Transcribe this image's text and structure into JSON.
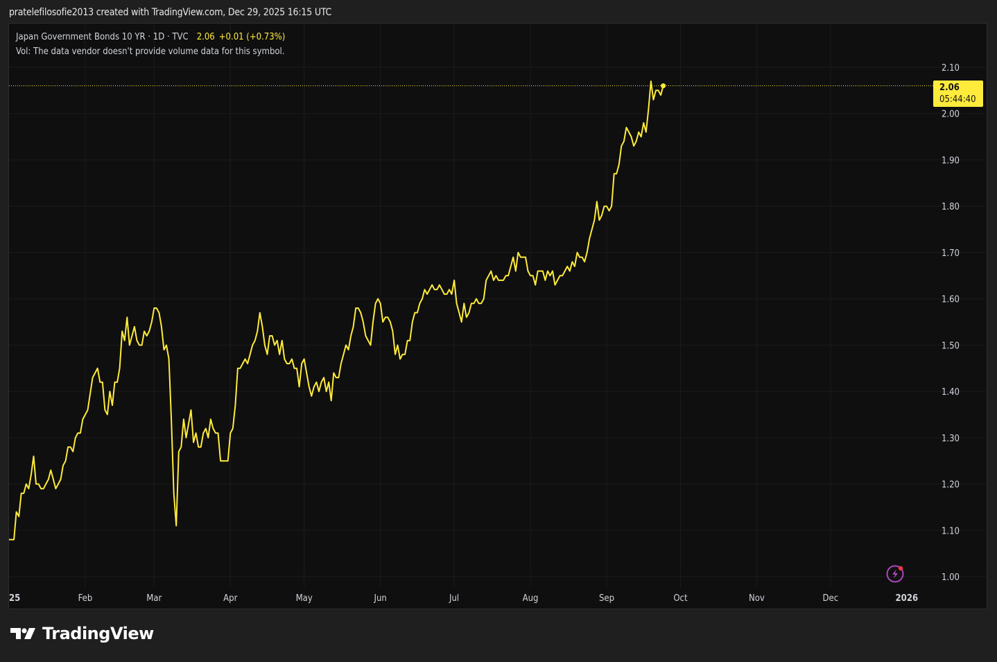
{
  "header": {
    "attribution": "pratelefilosofie2013 created with TradingView.com, Dec 29, 2025 16:15 UTC"
  },
  "legend": {
    "symbol": "Japan Government Bonds 10 YR · 1D · TVC",
    "last": "2.06",
    "change": "+0.01 (+0.73%)",
    "vol_note": "Vol: The data vendor doesn't provide volume data for this symbol."
  },
  "price_tag": {
    "price": "2.06",
    "countdown": "05:44:40"
  },
  "footer": {
    "brand": "TradingView"
  },
  "colors": {
    "line": "#ffeb3b",
    "background": "#0f0f0f",
    "grid": "#1c1c1c",
    "text": "#d1d4dc",
    "alert_icon": "#ab47bc",
    "alert_dot": "#f23645"
  },
  "icons": {
    "alert": "lightning-alert-icon",
    "logo": "tradingview-logo-icon"
  },
  "chart_data": {
    "type": "line",
    "title": "",
    "xlabel": "",
    "ylabel": "",
    "ylim": [
      1.0,
      2.1
    ],
    "yticks": [
      "2.10",
      "2.00",
      "1.90",
      "1.80",
      "1.70",
      "1.60",
      "1.50",
      "1.40",
      "1.30",
      "1.20",
      "1.10",
      "1.00"
    ],
    "xticks": [
      {
        "label": "25",
        "day": 0
      },
      {
        "label": "Feb",
        "day": 31
      },
      {
        "label": "Mar",
        "day": 59
      },
      {
        "label": "Apr",
        "day": 90
      },
      {
        "label": "May",
        "day": 120
      },
      {
        "label": "Jun",
        "day": 151
      },
      {
        "label": "Jul",
        "day": 181
      },
      {
        "label": "Aug",
        "day": 212
      },
      {
        "label": "Sep",
        "day": 243
      },
      {
        "label": "Oct",
        "day": 273
      },
      {
        "label": "Nov",
        "day": 304
      },
      {
        "label": "Dec",
        "day": 334
      },
      {
        "label": "2026",
        "day": 365
      }
    ],
    "grid": true,
    "last_value": 2.06,
    "series": [
      {
        "points": [
          [
            0,
            1.08
          ],
          [
            2,
            1.08
          ],
          [
            3,
            1.14
          ],
          [
            4,
            1.13
          ],
          [
            5,
            1.18
          ],
          [
            6,
            1.18
          ],
          [
            7,
            1.2
          ],
          [
            8,
            1.19
          ],
          [
            9,
            1.22
          ],
          [
            10,
            1.26
          ],
          [
            11,
            1.2
          ],
          [
            12,
            1.2
          ],
          [
            13,
            1.19
          ],
          [
            14,
            1.19
          ],
          [
            15,
            1.2
          ],
          [
            16,
            1.21
          ],
          [
            17,
            1.23
          ],
          [
            18,
            1.21
          ],
          [
            19,
            1.19
          ],
          [
            20,
            1.2
          ],
          [
            21,
            1.21
          ],
          [
            22,
            1.24
          ],
          [
            23,
            1.25
          ],
          [
            24,
            1.28
          ],
          [
            25,
            1.28
          ],
          [
            26,
            1.27
          ],
          [
            27,
            1.3
          ],
          [
            28,
            1.31
          ],
          [
            29,
            1.31
          ],
          [
            30,
            1.34
          ],
          [
            31,
            1.35
          ],
          [
            32,
            1.36
          ],
          [
            34,
            1.43
          ],
          [
            35,
            1.44
          ],
          [
            36,
            1.45
          ],
          [
            37,
            1.42
          ],
          [
            38,
            1.42
          ],
          [
            39,
            1.36
          ],
          [
            40,
            1.35
          ],
          [
            41,
            1.4
          ],
          [
            42,
            1.37
          ],
          [
            43,
            1.42
          ],
          [
            44,
            1.42
          ],
          [
            45,
            1.45
          ],
          [
            46,
            1.53
          ],
          [
            47,
            1.51
          ],
          [
            48,
            1.56
          ],
          [
            49,
            1.5
          ],
          [
            50,
            1.52
          ],
          [
            51,
            1.54
          ],
          [
            52,
            1.51
          ],
          [
            53,
            1.5
          ],
          [
            54,
            1.5
          ],
          [
            55,
            1.53
          ],
          [
            56,
            1.52
          ],
          [
            57,
            1.53
          ],
          [
            58,
            1.55
          ],
          [
            59,
            1.58
          ],
          [
            60,
            1.58
          ],
          [
            61,
            1.57
          ],
          [
            62,
            1.54
          ],
          [
            63,
            1.49
          ],
          [
            64,
            1.5
          ],
          [
            65,
            1.47
          ],
          [
            66,
            1.34
          ],
          [
            67,
            1.18
          ],
          [
            68,
            1.11
          ],
          [
            69,
            1.27
          ],
          [
            70,
            1.28
          ],
          [
            71,
            1.34
          ],
          [
            72,
            1.3
          ],
          [
            73,
            1.33
          ],
          [
            74,
            1.36
          ],
          [
            75,
            1.29
          ],
          [
            76,
            1.31
          ],
          [
            77,
            1.28
          ],
          [
            78,
            1.28
          ],
          [
            79,
            1.31
          ],
          [
            80,
            1.32
          ],
          [
            81,
            1.3
          ],
          [
            82,
            1.34
          ],
          [
            83,
            1.32
          ],
          [
            84,
            1.31
          ],
          [
            85,
            1.31
          ],
          [
            86,
            1.25
          ],
          [
            87,
            1.25
          ],
          [
            88,
            1.25
          ],
          [
            89,
            1.25
          ],
          [
            90,
            1.31
          ],
          [
            91,
            1.32
          ],
          [
            92,
            1.37
          ],
          [
            93,
            1.45
          ],
          [
            94,
            1.45
          ],
          [
            95,
            1.46
          ],
          [
            96,
            1.47
          ],
          [
            97,
            1.46
          ],
          [
            98,
            1.48
          ],
          [
            99,
            1.5
          ],
          [
            100,
            1.51
          ],
          [
            101,
            1.53
          ],
          [
            102,
            1.57
          ],
          [
            103,
            1.54
          ],
          [
            104,
            1.5
          ],
          [
            105,
            1.48
          ],
          [
            106,
            1.52
          ],
          [
            107,
            1.52
          ],
          [
            108,
            1.5
          ],
          [
            109,
            1.51
          ],
          [
            110,
            1.48
          ],
          [
            111,
            1.51
          ],
          [
            112,
            1.47
          ],
          [
            113,
            1.46
          ],
          [
            114,
            1.46
          ],
          [
            115,
            1.47
          ],
          [
            116,
            1.45
          ],
          [
            117,
            1.45
          ],
          [
            118,
            1.41
          ],
          [
            119,
            1.46
          ],
          [
            120,
            1.47
          ],
          [
            121,
            1.44
          ],
          [
            122,
            1.41
          ],
          [
            123,
            1.39
          ],
          [
            124,
            1.41
          ],
          [
            125,
            1.42
          ],
          [
            126,
            1.4
          ],
          [
            127,
            1.42
          ],
          [
            128,
            1.43
          ],
          [
            129,
            1.4
          ],
          [
            130,
            1.42
          ],
          [
            131,
            1.38
          ],
          [
            132,
            1.44
          ],
          [
            133,
            1.43
          ],
          [
            134,
            1.43
          ],
          [
            135,
            1.46
          ],
          [
            136,
            1.48
          ],
          [
            137,
            1.5
          ],
          [
            138,
            1.49
          ],
          [
            139,
            1.52
          ],
          [
            140,
            1.54
          ],
          [
            141,
            1.58
          ],
          [
            142,
            1.58
          ],
          [
            143,
            1.57
          ],
          [
            144,
            1.55
          ],
          [
            145,
            1.52
          ],
          [
            146,
            1.51
          ],
          [
            147,
            1.5
          ],
          [
            148,
            1.55
          ],
          [
            149,
            1.59
          ],
          [
            150,
            1.6
          ],
          [
            151,
            1.59
          ],
          [
            152,
            1.55
          ],
          [
            153,
            1.56
          ],
          [
            154,
            1.56
          ],
          [
            155,
            1.55
          ],
          [
            156,
            1.53
          ],
          [
            157,
            1.48
          ],
          [
            158,
            1.5
          ],
          [
            159,
            1.47
          ],
          [
            160,
            1.48
          ],
          [
            161,
            1.48
          ],
          [
            162,
            1.51
          ],
          [
            163,
            1.51
          ],
          [
            164,
            1.55
          ],
          [
            165,
            1.57
          ],
          [
            166,
            1.57
          ],
          [
            167,
            1.59
          ],
          [
            168,
            1.6
          ],
          [
            169,
            1.62
          ],
          [
            170,
            1.61
          ],
          [
            171,
            1.62
          ],
          [
            172,
            1.63
          ],
          [
            173,
            1.62
          ],
          [
            174,
            1.62
          ],
          [
            175,
            1.63
          ],
          [
            176,
            1.62
          ],
          [
            177,
            1.61
          ],
          [
            178,
            1.61
          ],
          [
            179,
            1.62
          ],
          [
            180,
            1.61
          ],
          [
            181,
            1.64
          ],
          [
            182,
            1.59
          ],
          [
            183,
            1.57
          ],
          [
            184,
            1.55
          ],
          [
            185,
            1.59
          ],
          [
            186,
            1.56
          ],
          [
            187,
            1.57
          ],
          [
            188,
            1.59
          ],
          [
            189,
            1.59
          ],
          [
            190,
            1.6
          ],
          [
            191,
            1.59
          ],
          [
            192,
            1.59
          ],
          [
            193,
            1.6
          ],
          [
            194,
            1.64
          ],
          [
            195,
            1.65
          ],
          [
            196,
            1.66
          ],
          [
            197,
            1.64
          ],
          [
            198,
            1.65
          ],
          [
            199,
            1.64
          ],
          [
            200,
            1.64
          ],
          [
            201,
            1.64
          ],
          [
            202,
            1.65
          ],
          [
            203,
            1.65
          ],
          [
            204,
            1.67
          ],
          [
            205,
            1.69
          ],
          [
            206,
            1.66
          ],
          [
            207,
            1.7
          ],
          [
            208,
            1.69
          ],
          [
            209,
            1.69
          ],
          [
            210,
            1.69
          ],
          [
            211,
            1.66
          ],
          [
            212,
            1.65
          ],
          [
            213,
            1.65
          ],
          [
            214,
            1.63
          ],
          [
            215,
            1.66
          ],
          [
            216,
            1.66
          ],
          [
            217,
            1.66
          ],
          [
            218,
            1.64
          ],
          [
            219,
            1.66
          ],
          [
            220,
            1.65
          ],
          [
            221,
            1.66
          ],
          [
            222,
            1.63
          ],
          [
            223,
            1.64
          ],
          [
            224,
            1.65
          ],
          [
            225,
            1.65
          ],
          [
            226,
            1.66
          ],
          [
            227,
            1.67
          ],
          [
            228,
            1.66
          ],
          [
            229,
            1.68
          ],
          [
            230,
            1.67
          ],
          [
            231,
            1.7
          ],
          [
            232,
            1.69
          ],
          [
            233,
            1.69
          ],
          [
            234,
            1.68
          ],
          [
            235,
            1.7
          ],
          [
            236,
            1.73
          ],
          [
            237,
            1.75
          ],
          [
            238,
            1.77
          ],
          [
            239,
            1.81
          ],
          [
            240,
            1.77
          ],
          [
            241,
            1.78
          ],
          [
            242,
            1.8
          ],
          [
            243,
            1.8
          ],
          [
            244,
            1.79
          ],
          [
            245,
            1.8
          ],
          [
            246,
            1.87
          ],
          [
            247,
            1.87
          ],
          [
            248,
            1.89
          ],
          [
            249,
            1.93
          ],
          [
            250,
            1.94
          ],
          [
            251,
            1.97
          ],
          [
            252,
            1.96
          ],
          [
            253,
            1.95
          ],
          [
            254,
            1.93
          ],
          [
            255,
            1.94
          ],
          [
            256,
            1.96
          ],
          [
            257,
            1.95
          ],
          [
            258,
            1.98
          ],
          [
            259,
            1.96
          ],
          [
            260,
            2.01
          ],
          [
            261,
            2.07
          ],
          [
            262,
            2.03
          ],
          [
            263,
            2.05
          ],
          [
            264,
            2.05
          ],
          [
            265,
            2.04
          ],
          [
            266,
            2.06
          ]
        ]
      }
    ]
  }
}
